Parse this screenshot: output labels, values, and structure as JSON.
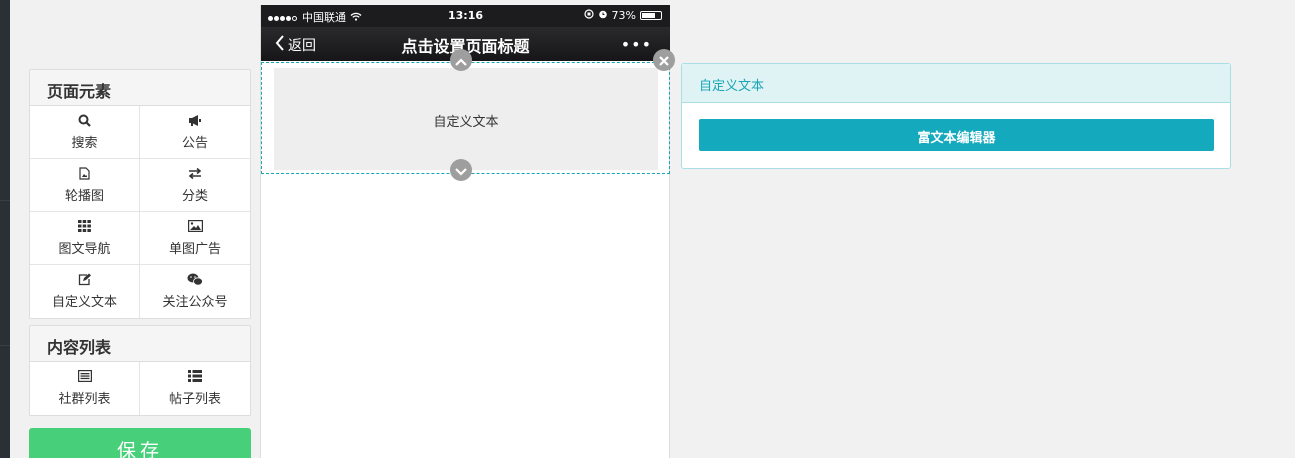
{
  "page_elements": {
    "title": "页面元素",
    "items": [
      {
        "label": "搜索",
        "icon": "search-icon"
      },
      {
        "label": "公告",
        "icon": "bullhorn-icon"
      },
      {
        "label": "轮播图",
        "icon": "file-image-icon"
      },
      {
        "label": "分类",
        "icon": "exchange-icon"
      },
      {
        "label": "图文导航",
        "icon": "grid-icon"
      },
      {
        "label": "单图广告",
        "icon": "picture-icon"
      },
      {
        "label": "自定义文本",
        "icon": "edit-icon"
      },
      {
        "label": "关注公众号",
        "icon": "wechat-icon"
      }
    ]
  },
  "content_list": {
    "title": "内容列表",
    "items": [
      {
        "label": "社群列表",
        "icon": "list-alt-icon"
      },
      {
        "label": "帖子列表",
        "icon": "list-icon"
      }
    ]
  },
  "save_label": "保存",
  "phone": {
    "carrier": "中国联通",
    "time": "13:16",
    "battery_text": "73%",
    "battery_level": 0.73,
    "back_label": "返回",
    "title": "点击设置页面标题",
    "more": "•••",
    "block_text": "自定义文本"
  },
  "editor": {
    "header": "自定义文本",
    "button_label": "富文本编辑器"
  },
  "colors": {
    "accent": "#14a9bc",
    "save": "#48cf7a"
  }
}
